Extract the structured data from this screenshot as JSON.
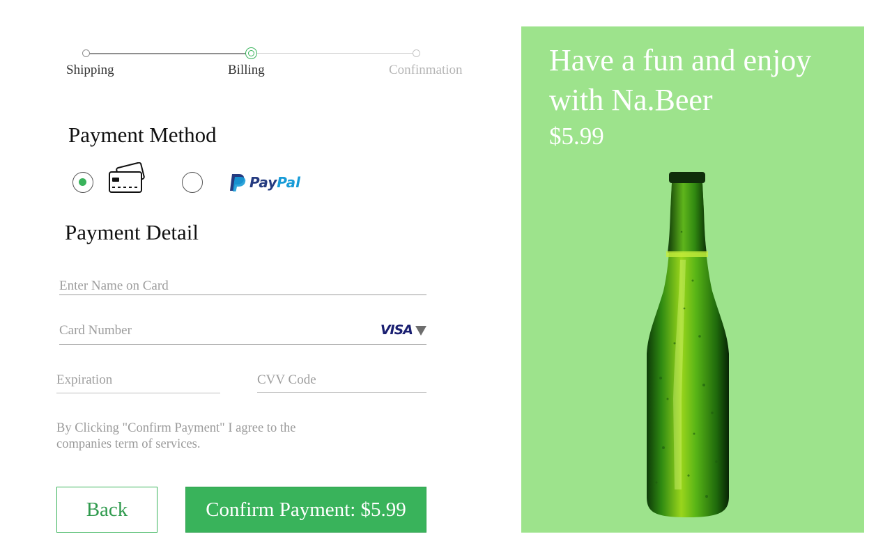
{
  "stepper": {
    "steps": [
      {
        "label": "Shipping",
        "state": "done"
      },
      {
        "label": "Billing",
        "state": "current"
      },
      {
        "label": "Confinmation",
        "state": "upcoming"
      }
    ]
  },
  "payment_method": {
    "title": "Payment Method",
    "options": [
      {
        "name": "credit-card",
        "icon": "credit-card-icon",
        "selected": true
      },
      {
        "name": "paypal",
        "icon": "paypal-logo",
        "selected": false,
        "logo_text_1": "Pay",
        "logo_text_2": "Pal"
      }
    ]
  },
  "payment_detail": {
    "title": "Payment Detail",
    "name_on_card": {
      "placeholder": "Enter Name on Card",
      "value": ""
    },
    "card_number": {
      "placeholder": "Card Number",
      "value": "",
      "card_brand": "VISA"
    },
    "expiration": {
      "placeholder": "Expiration",
      "value": ""
    },
    "cvv": {
      "placeholder": "CVV Code",
      "value": ""
    }
  },
  "terms_text": "By Clicking \"Confirm Payment\" I agree to the companies term of services.",
  "buttons": {
    "back_label": "Back",
    "confirm_label": "Confirm Payment: $5.99"
  },
  "promo": {
    "title": "Have a fun and enjoy with Na.Beer",
    "price": "$5.99",
    "image": "green-beer-bottle"
  },
  "colors": {
    "accent_green": "#39b35b",
    "promo_background": "#9de38c",
    "muted_text": "#9a9a9a"
  }
}
